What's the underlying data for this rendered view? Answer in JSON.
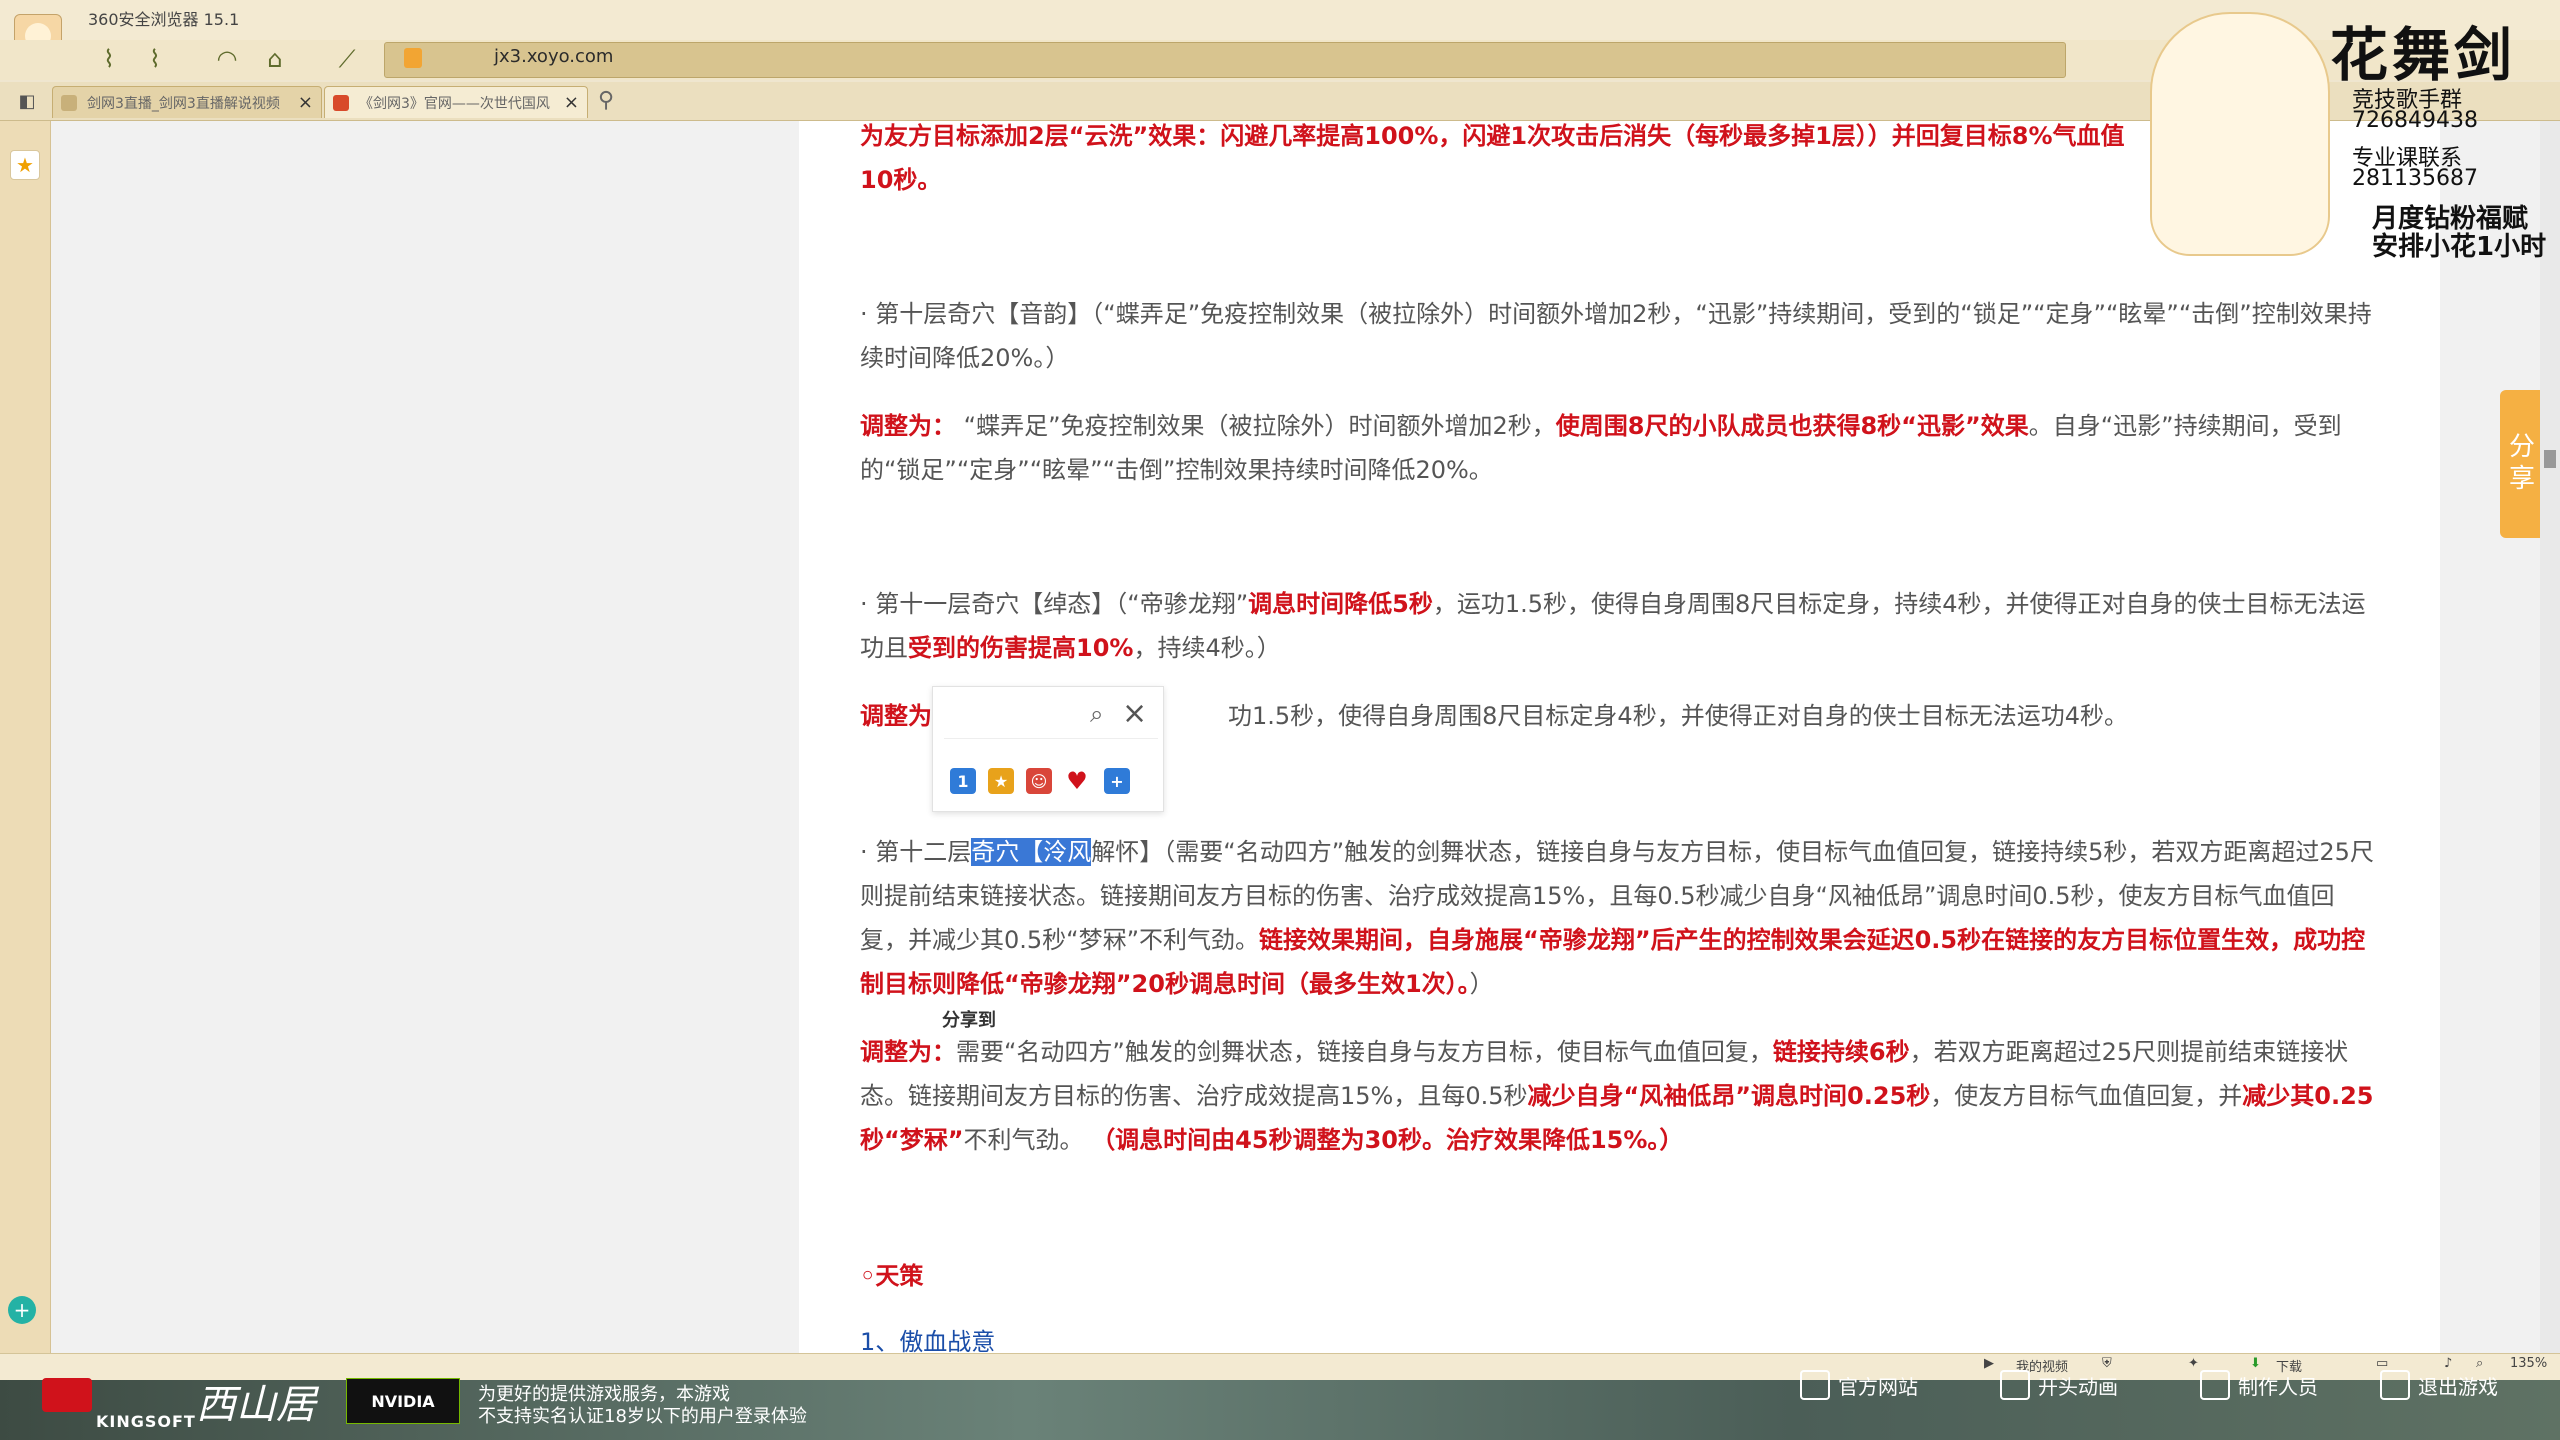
{
  "browser": {
    "title": "360安全浏览器 15.1",
    "address": "jx3.xoyo.com",
    "tabs": [
      {
        "label": "剑网3直播_剑网3直播解说视频"
      },
      {
        "label": "《剑网3》官网——次世代国风"
      }
    ],
    "close_glyph": "×"
  },
  "article": {
    "p1": "为友方目标添加2层“云洗”效果：闪避几率提高100%，闪避1次攻击后消失（每秒最多掉1层））并回复目标8%气血值",
    "p1b": "10秒。",
    "p2": "· 第十层奇穴【音韵】（“蝶弄足”免疫控制效果（被拉除外）时间额外增加2秒，“迅影”持续期间，受到的“锁足”“定身”“眩晕”“击倒”控制效果持续时间降低20%。）",
    "p3_label": "调整为：",
    "p3_a": "“蝶弄足”免疫控制效果（被拉除外）时间额外增加2秒，",
    "p3_b": "使周围8尺的小队成员也获得8秒“迅影”效果",
    "p3_c": "。自身“迅影”持续期间，受到的“锁足”“定身”“眩晕”“击倒”控制效果持续时间降低20%。",
    "p4_a": "· 第十一层奇穴【绰态】（“帝骖龙翔”",
    "p4_b": "调息时间降低5秒",
    "p4_c": "，运功1.5秒，使得自身周围8尺目标定身，持续4秒，并使得正对自身的侠士目标无法运功且",
    "p4_d": "受到的伤害提高10%",
    "p4_e": "，持续4秒。）",
    "p5_label": "调整为",
    "p5_text": "功1.5秒，使得自身周围8尺目标定身4秒，并使得正对自身的侠士目标无法运功4秒。",
    "p6_a": "· 第十二层",
    "p6_sel": "奇穴【泠风",
    "p6_b": "解怀】（需要“名动四方”触发的剑舞状态，链接自身与友方目标，使目标气血值回复，链接持续5秒，若双方距离超过25尺则提前结束链接状态。链接期间友方目标的伤害、治疗成效提高15%，且每0.5秒减少自身“风袖低昂”调息时间0.5秒，使友方目标气血值回复，并减少其0.5秒“梦冧”不利气劲。",
    "p6_red": "链接效果期间，自身施展“帝骖龙翔”后产生的控制效果会延迟0.5秒在链接的友方目标位置生效，成功控制目标则降低“帝骖龙翔”20秒调息时间（最多生效1次）。",
    "p6_end": "）",
    "share_to": "分享到",
    "p7_label": "调整为：",
    "p7_a": "需要“名动四方”触发的剑舞状态，链接自身与友方目标，使目标气血值回复，",
    "p7_b": "链接持续6秒",
    "p7_c": "，若双方距离超过25尺则提前结束链接状态。链接期间友方目标的伤害、治疗成效提高15%，且每0.5秒",
    "p7_d": "减少自身“风袖低昂”调息时间0.25秒",
    "p7_e": "，使友方目标气血值回复，并",
    "p7_f": "减少其0.25秒“梦冧”",
    "p7_g": "不利气劲。",
    "p7_h": "（调息时间由45秒调整为30秒。治疗效果降低15%。）",
    "section": "◦天策",
    "link1": "1、傲血战意"
  },
  "share_tab": "分享",
  "popup": {
    "icons": [
      "1",
      "★",
      "☺",
      "♥",
      "+"
    ],
    "icon_colors": [
      "#2f7bd8",
      "#e8a21b",
      "#d9463a",
      "#d0121b",
      "#2f7bd8"
    ]
  },
  "watermark": {
    "title": "花舞剑",
    "line1": "竞技歌手群",
    "line2": "726849438",
    "line3": "专业课联系",
    "line4": "281135687",
    "line5": "月度钻粉福赋",
    "line6": "安排小花1小时"
  },
  "statusbar": {
    "my_video": "我的视频",
    "download": "下载",
    "zoom": "135%"
  },
  "game": {
    "kingsoft": "KINGSOFT",
    "xsj": "西山居",
    "nvidia": "NVIDIA",
    "notice1": "为更好的提供游戏服务，本游戏",
    "notice2": "不支持实名认证18岁以下的用户登录体验",
    "btn1": "官方网站",
    "btn2": "开头动画",
    "btn3": "制作人员",
    "btn4": "退出游戏"
  }
}
